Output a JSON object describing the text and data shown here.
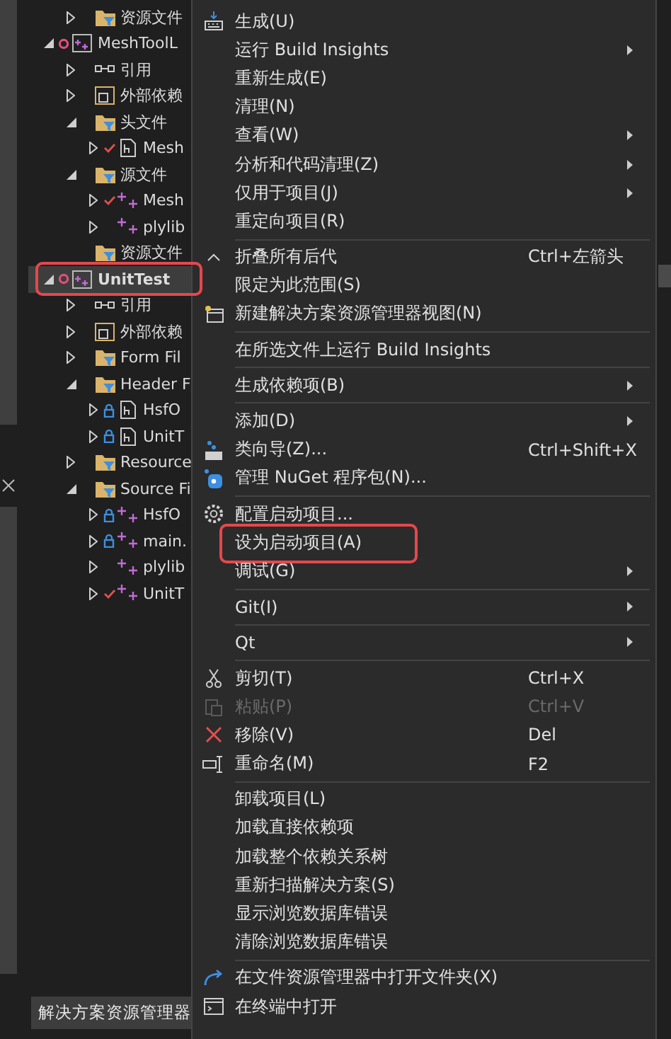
{
  "tree": [
    {
      "children": [
        {
          "label": "资源文件",
          "kind": "folder",
          "expanded": false
        }
      ]
    },
    {
      "label": "MeshToolL",
      "kind": "project",
      "flagged": true,
      "expanded": true,
      "selected": false,
      "children": [
        {
          "label": "引用",
          "kind": "references",
          "expanded": false
        },
        {
          "label": "外部依赖",
          "kind": "dependencies",
          "expanded": false
        },
        {
          "label": "头文件",
          "kind": "folder",
          "expanded": true,
          "children": [
            {
              "label": "Mesh",
              "kind": "header",
              "modified": true,
              "expanded": false
            }
          ]
        },
        {
          "label": "源文件",
          "kind": "folder",
          "expanded": true,
          "children": [
            {
              "label": "Mesh",
              "kind": "source",
              "modified": true,
              "expanded": false
            },
            {
              "label": "plylib",
              "kind": "source",
              "expanded": false
            }
          ]
        },
        {
          "label": "资源文件",
          "kind": "folder"
        }
      ]
    },
    {
      "label": "UnitTest",
      "kind": "project",
      "flagged": true,
      "expanded": true,
      "selected": true,
      "outlined": true,
      "children": [
        {
          "label": "引用",
          "kind": "references",
          "expanded": false
        },
        {
          "label": "外部依赖",
          "kind": "dependencies",
          "expanded": false
        },
        {
          "label": "Form Fil",
          "kind": "folder",
          "expanded": false
        },
        {
          "label": "Header F",
          "kind": "folder",
          "expanded": true,
          "children": [
            {
              "label": "HsfO",
              "kind": "header",
              "locked": true,
              "expanded": false
            },
            {
              "label": "UnitT",
              "kind": "header",
              "locked": true,
              "expanded": false
            }
          ]
        },
        {
          "label": "Resource",
          "kind": "folder",
          "expanded": false
        },
        {
          "label": "Source Fi",
          "kind": "folder",
          "expanded": true,
          "children": [
            {
              "label": "HsfO",
              "kind": "source",
              "locked": true,
              "expanded": false
            },
            {
              "label": "main.",
              "kind": "source",
              "locked": true,
              "expanded": false
            },
            {
              "label": "plylib",
              "kind": "source",
              "expanded": false
            },
            {
              "label": "UnitT",
              "kind": "source",
              "modified": true,
              "expanded": false
            }
          ]
        }
      ]
    }
  ],
  "panel_tab": "解决方案资源管理器",
  "menu": [
    {
      "kind": "item",
      "label": "生成(U)"
    },
    {
      "kind": "item",
      "label": "运行 Build Insights",
      "submenu": true
    },
    {
      "kind": "item",
      "label": "重新生成(E)"
    },
    {
      "kind": "item",
      "label": "清理(N)"
    },
    {
      "kind": "item",
      "label": "查看(W)",
      "submenu": true
    },
    {
      "kind": "item",
      "label": "分析和代码清理(Z)",
      "submenu": true
    },
    {
      "kind": "item",
      "label": "仅用于项目(J)",
      "submenu": true
    },
    {
      "kind": "item",
      "label": "重定向项目(R)"
    },
    {
      "kind": "separator"
    },
    {
      "kind": "item",
      "label": "折叠所有后代",
      "shortcut": "Ctrl+左箭头"
    },
    {
      "kind": "item",
      "label": "限定为此范围(S)"
    },
    {
      "kind": "item",
      "label": "新建解决方案资源管理器视图(N)"
    },
    {
      "kind": "separator"
    },
    {
      "kind": "item",
      "label": "在所选文件上运行 Build Insights"
    },
    {
      "kind": "separator"
    },
    {
      "kind": "item",
      "label": "生成依赖项(B)",
      "submenu": true
    },
    {
      "kind": "separator"
    },
    {
      "kind": "item",
      "label": "添加(D)",
      "submenu": true
    },
    {
      "kind": "item",
      "label": "类向导(Z)...",
      "shortcut": "Ctrl+Shift+X"
    },
    {
      "kind": "item",
      "label": "管理 NuGet 程序包(N)..."
    },
    {
      "kind": "separator"
    },
    {
      "kind": "item",
      "label": "配置启动项目..."
    },
    {
      "kind": "item",
      "label": "设为启动项目(A)",
      "outlined": true
    },
    {
      "kind": "item",
      "label": "调试(G)",
      "submenu": true
    },
    {
      "kind": "separator"
    },
    {
      "kind": "item",
      "label": "Git(I)",
      "submenu": true
    },
    {
      "kind": "separator"
    },
    {
      "kind": "item",
      "label": "Qt",
      "submenu": true
    },
    {
      "kind": "separator"
    },
    {
      "kind": "item",
      "label": "剪切(T)",
      "shortcut": "Ctrl+X"
    },
    {
      "kind": "item",
      "label": "粘贴(P)",
      "shortcut": "Ctrl+V",
      "disabled": true
    },
    {
      "kind": "item",
      "label": "移除(V)",
      "shortcut": "Del"
    },
    {
      "kind": "item",
      "label": "重命名(M)",
      "shortcut": "F2"
    },
    {
      "kind": "separator"
    },
    {
      "kind": "item",
      "label": "卸载项目(L)"
    },
    {
      "kind": "item",
      "label": "加载直接依赖项"
    },
    {
      "kind": "item",
      "label": "加载整个依赖关系树"
    },
    {
      "kind": "item",
      "label": "重新扫描解决方案(S)"
    },
    {
      "kind": "item",
      "label": "显示浏览数据库错误"
    },
    {
      "kind": "item",
      "label": "清除浏览数据库错误"
    },
    {
      "kind": "separator"
    },
    {
      "kind": "item",
      "label": "在文件资源管理器中打开文件夹(X)"
    },
    {
      "kind": "item",
      "label": "在终端中打开"
    }
  ]
}
